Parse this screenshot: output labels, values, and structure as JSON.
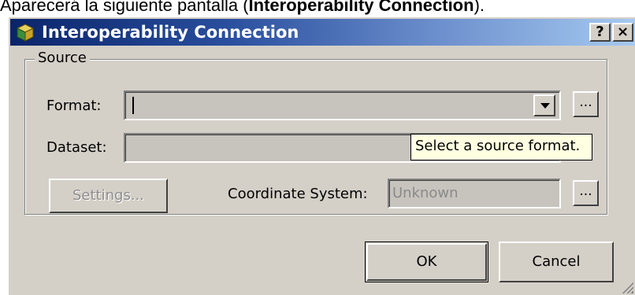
{
  "caption": {
    "prefix": "Aparecerá la siguiente pantalla (",
    "bold": "Interoperability Connection",
    "suffix": ")."
  },
  "window": {
    "title": "Interoperability Connection",
    "help_label": "?",
    "close_label": "×"
  },
  "source_group": {
    "label": "Source",
    "format_label": "Format:",
    "format_value": "",
    "format_browse_label": "...",
    "dataset_label": "Dataset:",
    "dataset_value": "",
    "settings_label": "Settings...",
    "coordinate_label": "Coordinate System:",
    "coordinate_value": "Unknown",
    "coordinate_browse_label": "..."
  },
  "tooltip": {
    "text": "Select a source format."
  },
  "actions": {
    "ok_label": "OK",
    "cancel_label": "Cancel"
  }
}
